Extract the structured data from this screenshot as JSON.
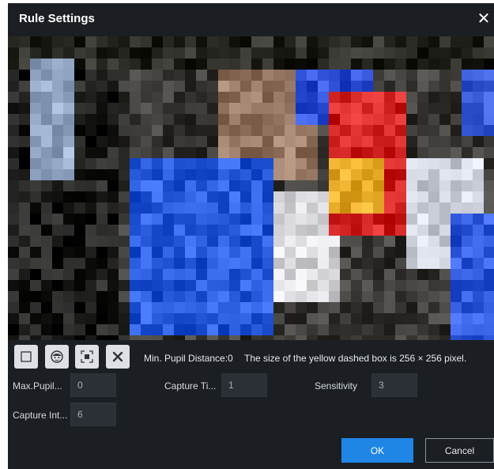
{
  "dialog": {
    "title": "Rule Settings",
    "close_icon": "close-icon"
  },
  "preview": {
    "description_icon": "video-preview"
  },
  "toolbar": {
    "tools": [
      {
        "icon": "draw-rectangle-icon"
      },
      {
        "icon": "face-icon"
      },
      {
        "icon": "target-box-icon"
      },
      {
        "icon": "delete-icon"
      }
    ],
    "min_pupil_text": "Min. Pupil Distance:0",
    "box_size_text": "The size of the yellow dashed box is 256 × 256 pixel."
  },
  "fields": {
    "max_pupil_label": "Max.Pupil...",
    "max_pupil_value": "0",
    "capture_time_label": "Capture Ti...",
    "capture_time_value": "1",
    "sensitivity_label": "Sensitivity",
    "sensitivity_value": "3",
    "capture_interval_label": "Capture Int...",
    "capture_interval_value": "6"
  },
  "buttons": {
    "ok": "OK",
    "cancel": "Cancel"
  },
  "colors": {
    "dialog_bg": "#1b1f24",
    "accent": "#1f86e6",
    "input_bg": "#2b3037"
  }
}
